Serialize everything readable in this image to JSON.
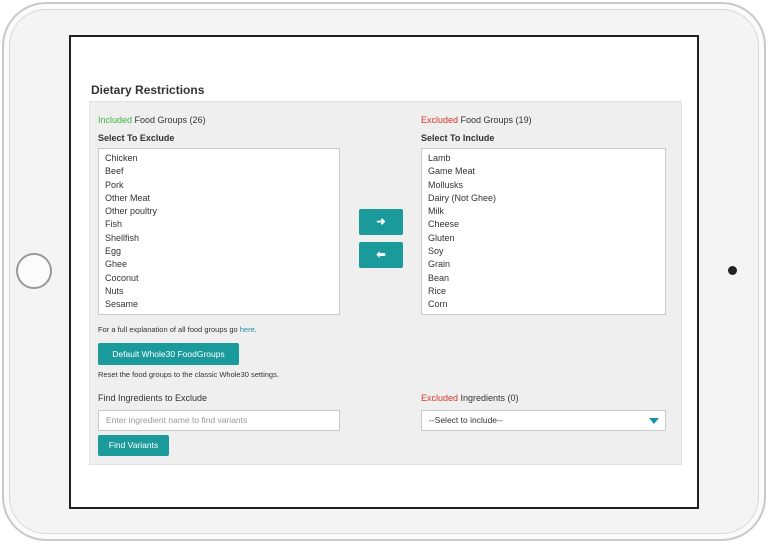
{
  "page": {
    "title": "Dietary Restrictions"
  },
  "included": {
    "status_word": "Included",
    "label_rest": " Food Groups (26)",
    "sublabel": "Select To Exclude",
    "items": [
      "Chicken",
      "Beef",
      "Pork",
      "Other Meat",
      "Other poultry",
      "Fish",
      "Shellfish",
      "Egg",
      "Ghee",
      "Coconut",
      "Nuts",
      "Sesame"
    ]
  },
  "excluded": {
    "status_word": "Excluded",
    "label_rest": " Food Groups (19)",
    "sublabel": "Select To Include",
    "items": [
      "Lamb",
      "Game Meat",
      "Mollusks",
      "Dairy (Not Ghee)",
      "Milk",
      "Cheese",
      "Gluten",
      "Soy",
      "Grain",
      "Bean",
      "Rice",
      "Corn"
    ]
  },
  "transfer": {
    "right_glyph": "➜",
    "left_glyph": "⬅"
  },
  "explanation": {
    "text": "For a full explanation of all food groups go ",
    "link": "here",
    "suffix": "."
  },
  "defaults": {
    "button_label": "Default Whole30 FoodGroups",
    "note": "Reset the food groups to the classic Whole30 settings."
  },
  "find": {
    "label": "Find Ingredients to Exclude",
    "placeholder": "Enter ingredient name to find variants",
    "button_label": "Find Variants"
  },
  "excluded_ingredients": {
    "status_word": "Excluded",
    "label_rest": " Ingredients (0)",
    "select_value": "--Select to include--"
  },
  "colors": {
    "accent": "#1a9a9b",
    "included": "#3fb53f",
    "excluded": "#d9342b"
  },
  "icons": {
    "arrow_right": "arrow-right-icon",
    "arrow_left": "arrow-left-icon",
    "dropdown_caret": "chevron-down-icon"
  }
}
